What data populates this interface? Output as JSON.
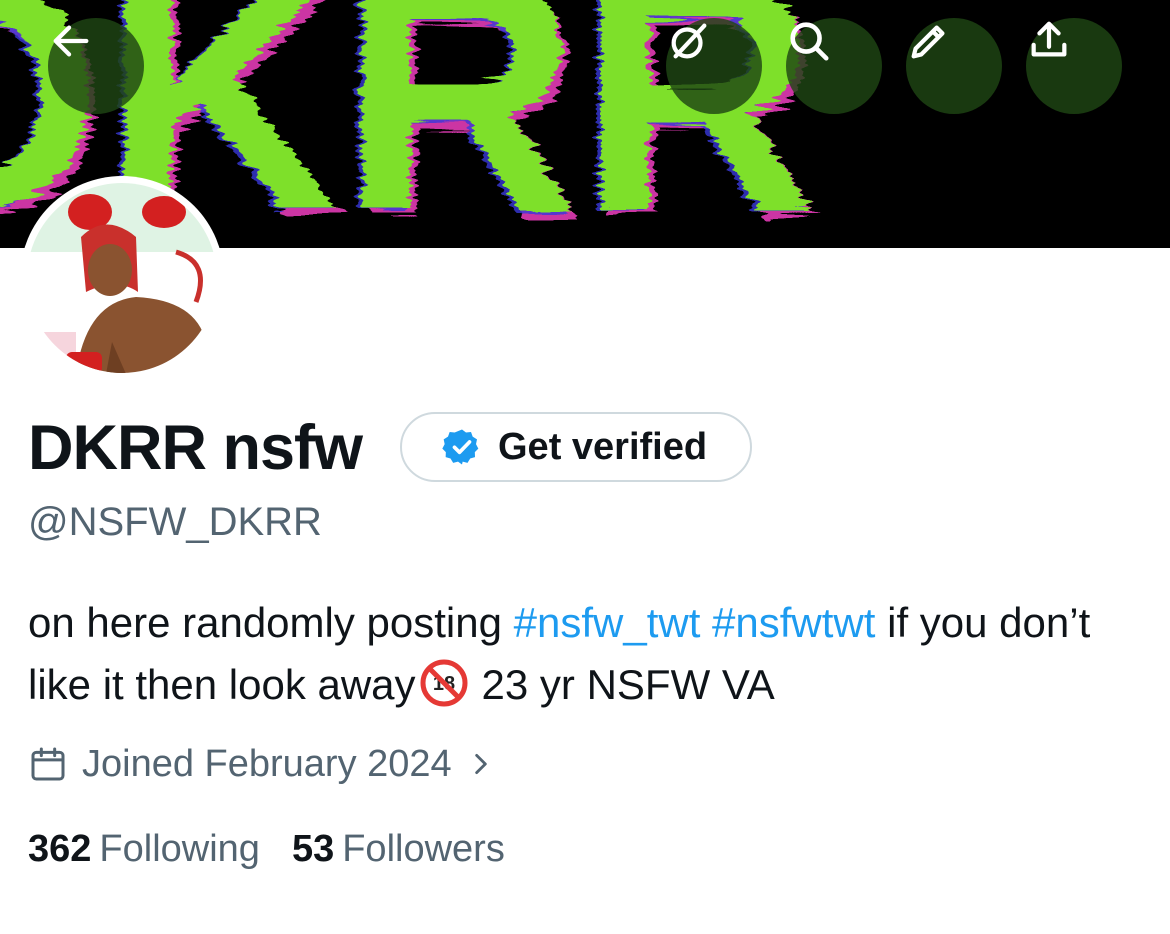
{
  "header": {
    "banner_text": "DKRR",
    "buttons": [
      {
        "name": "back-button",
        "icon": "arrow-left-icon"
      },
      {
        "name": "grok-button",
        "icon": "grok-icon"
      },
      {
        "name": "search-button",
        "icon": "search-icon"
      },
      {
        "name": "edit-button",
        "icon": "pencil-icon"
      },
      {
        "name": "share-button",
        "icon": "share-icon"
      }
    ]
  },
  "profile": {
    "display_name": "DKRR nsfw",
    "get_verified_label": "Get verified",
    "handle": "@NSFW_DKRR",
    "bio": {
      "part1": "on here randomly posting ",
      "tag1": "#nsfw_twt",
      "tag2": "#nsfwtwt",
      "part2": " if you don’t like it then look away",
      "emoji": "🔞",
      "part3": "23 yr NSFW VA"
    },
    "joined": "Joined February 2024",
    "following_count": "362",
    "following_label": "Following",
    "followers_count": "53",
    "followers_label": "Followers"
  },
  "colors": {
    "accent": "#1d9bf0",
    "secondary_text": "#536471",
    "banner_green": "#7ee02a",
    "button_bg": "#1e4614"
  }
}
